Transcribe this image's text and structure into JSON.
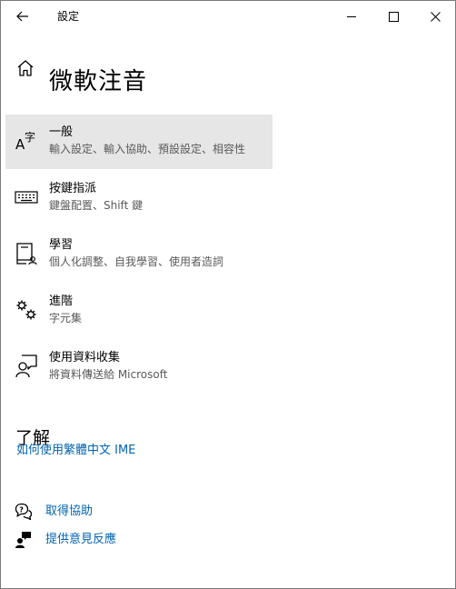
{
  "window": {
    "title": "設定"
  },
  "page": {
    "title": "微軟注音"
  },
  "items": [
    {
      "title": "一般",
      "subtitle": "輸入設定、輸入協助、預設設定、相容性",
      "icon": "language-character-icon",
      "selected": true
    },
    {
      "title": "按鍵指派",
      "subtitle": "鍵盤配置、Shift 鍵",
      "icon": "keyboard-icon",
      "selected": false
    },
    {
      "title": "學習",
      "subtitle": "個人化調整、自我學習、使用者造詞",
      "icon": "learning-book-icon",
      "selected": false
    },
    {
      "title": "進階",
      "subtitle": "字元集",
      "icon": "gears-icon",
      "selected": false
    },
    {
      "title": "使用資料收集",
      "subtitle": "將資料傳送給 Microsoft",
      "icon": "feedback-person-icon",
      "selected": false
    }
  ],
  "learn": {
    "heading": "了解",
    "link": "如何使用繁體中文 IME"
  },
  "help": {
    "get_help": "取得協助",
    "feedback": "提供意見反應"
  },
  "colors": {
    "link": "#0063b1",
    "selected_bg": "#e6e6e6",
    "secondary_text": "#5a5a5a"
  }
}
